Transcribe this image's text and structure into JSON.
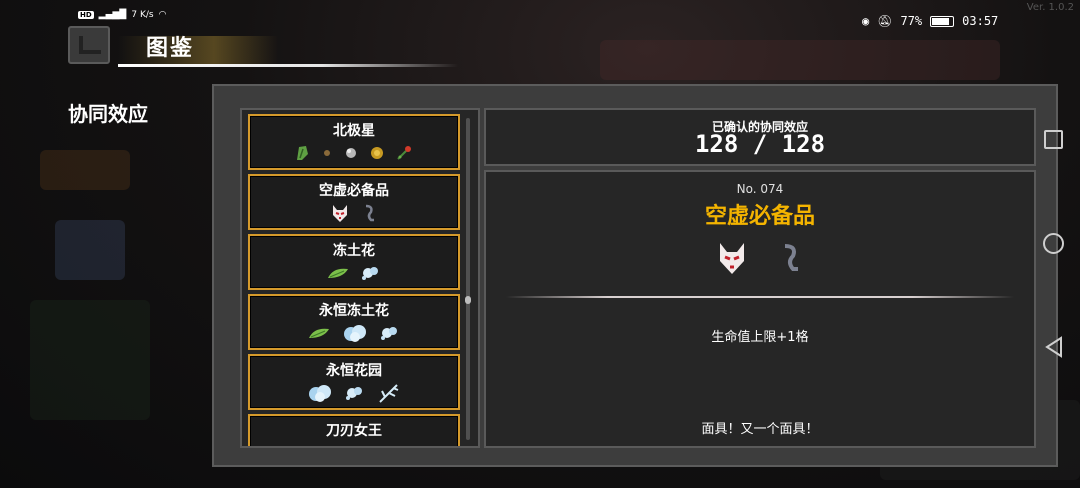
{
  "status_bar": {
    "left_text": "HD 4G 5G Tap",
    "net_speed": "7 K/s",
    "battery": "77%",
    "time": "03:57",
    "version": "Ver. 1.0.2"
  },
  "header": {
    "title": "图鉴",
    "section": "协同效应"
  },
  "list": {
    "items": [
      {
        "title": "北极星",
        "icons": [
          "green-leaf-icon",
          "small-seed-icon",
          "silver-orb-icon",
          "gold-coin-icon",
          "red-flower-icon"
        ]
      },
      {
        "title": "空虚必备品",
        "icons": [
          "fox-mask-icon",
          "grey-hook-icon"
        ]
      },
      {
        "title": "冻土花",
        "icons": [
          "green-leaf-icon",
          "snow-puff-icon"
        ]
      },
      {
        "title": "永恒冻土花",
        "icons": [
          "green-leaf-icon",
          "frost-cloud-icon",
          "snow-puff-icon"
        ]
      },
      {
        "title": "永恒花园",
        "icons": [
          "frost-cloud-icon",
          "snow-puff-icon",
          "frost-branch-icon"
        ]
      },
      {
        "title": "刀刃女王",
        "icons": []
      }
    ]
  },
  "counter": {
    "label": "已确认的协同效应",
    "value": "128 / 128"
  },
  "detail": {
    "number": "No. 074",
    "name": "空虚必备品",
    "icons": [
      "fox-mask-icon",
      "grey-hook-icon"
    ],
    "effect": "生命值上限+1格",
    "flavor": "面具！又一个面具！"
  },
  "colors": {
    "accent_gold": "#f4b400",
    "item_border": "#d59a2b",
    "panel_bg": "#3d3d3d",
    "box_bg": "#262626"
  }
}
